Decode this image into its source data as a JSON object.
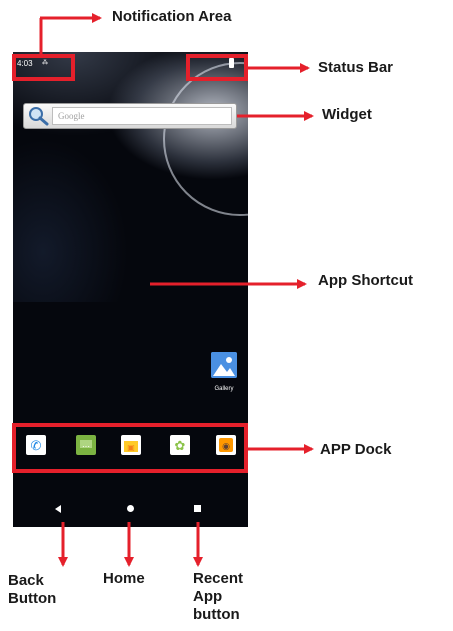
{
  "status_bar": {
    "time": "4:03",
    "notif": "⁂"
  },
  "widget": {
    "placeholder": "Google"
  },
  "shortcut": {
    "label": "Gallery"
  },
  "dock": {
    "items": [
      {
        "name": "phone-app-icon",
        "color": "#ffffff",
        "glyph": "✆"
      },
      {
        "name": "messaging-app-icon",
        "color": "#7cb342",
        "glyph": "…"
      },
      {
        "name": "briefcase-app-icon",
        "color": "#ffca28",
        "glyph": "▣"
      },
      {
        "name": "android-app-icon",
        "color": "#8bc34a",
        "glyph": "✿"
      },
      {
        "name": "camera-app-icon",
        "color": "#ff9800",
        "glyph": "◉"
      }
    ]
  },
  "annotations": {
    "notification_area": "Notification Area",
    "status_bar": "Status Bar",
    "widget": "Widget",
    "app_shortcut": "App Shortcut",
    "app_dock": "APP Dock",
    "back_button": "Back Button",
    "home": "Home",
    "recent_app_button": "Recent App button"
  },
  "colors": {
    "accent": "#e5202b"
  }
}
